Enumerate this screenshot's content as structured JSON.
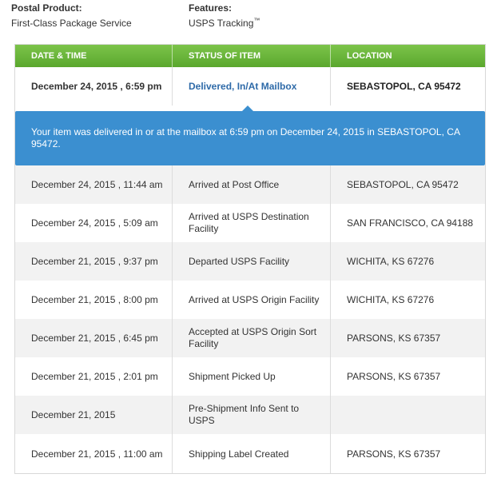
{
  "header": {
    "postal_product_label": "Postal Product:",
    "postal_product_value": "First-Class Package Service",
    "features_label": "Features:",
    "features_value": "USPS Tracking",
    "features_tm": "™"
  },
  "table": {
    "columns": [
      "DATE & TIME",
      "STATUS OF ITEM",
      "LOCATION"
    ],
    "current": {
      "date": "December 24, 2015 , 6:59 pm",
      "status": "Delivered, In/At Mailbox",
      "location": "SEBASTOPOL, CA 95472"
    },
    "detail": "Your item was delivered in or at the mailbox at 6:59 pm on December 24, 2015 in SEBASTOPOL, CA 95472.",
    "rows": [
      {
        "date": "December 24, 2015 , 11:44 am",
        "status": "Arrived at Post Office",
        "location": "SEBASTOPOL, CA 95472"
      },
      {
        "date": "December 24, 2015 , 5:09 am",
        "status": "Arrived at USPS Destination Facility",
        "location": "SAN FRANCISCO, CA 94188"
      },
      {
        "date": "December 21, 2015 , 9:37 pm",
        "status": "Departed USPS Facility",
        "location": "WICHITA, KS 67276"
      },
      {
        "date": "December 21, 2015 , 8:00 pm",
        "status": "Arrived at USPS Origin Facility",
        "location": "WICHITA, KS 67276"
      },
      {
        "date": "December 21, 2015 , 6:45 pm",
        "status": "Accepted at USPS Origin Sort Facility",
        "location": "PARSONS, KS 67357"
      },
      {
        "date": "December 21, 2015 , 2:01 pm",
        "status": "Shipment Picked Up",
        "location": "PARSONS, KS 67357"
      },
      {
        "date": "December 21, 2015",
        "status": "Pre-Shipment Info Sent to USPS",
        "location": ""
      },
      {
        "date": "December 21, 2015 , 11:00 am",
        "status": "Shipping Label Created",
        "location": "PARSONS, KS 67357"
      }
    ]
  },
  "colors": {
    "header_green": "#5aa72d",
    "callout_blue": "#3b8fd0",
    "status_link_blue": "#2e6aa8"
  }
}
